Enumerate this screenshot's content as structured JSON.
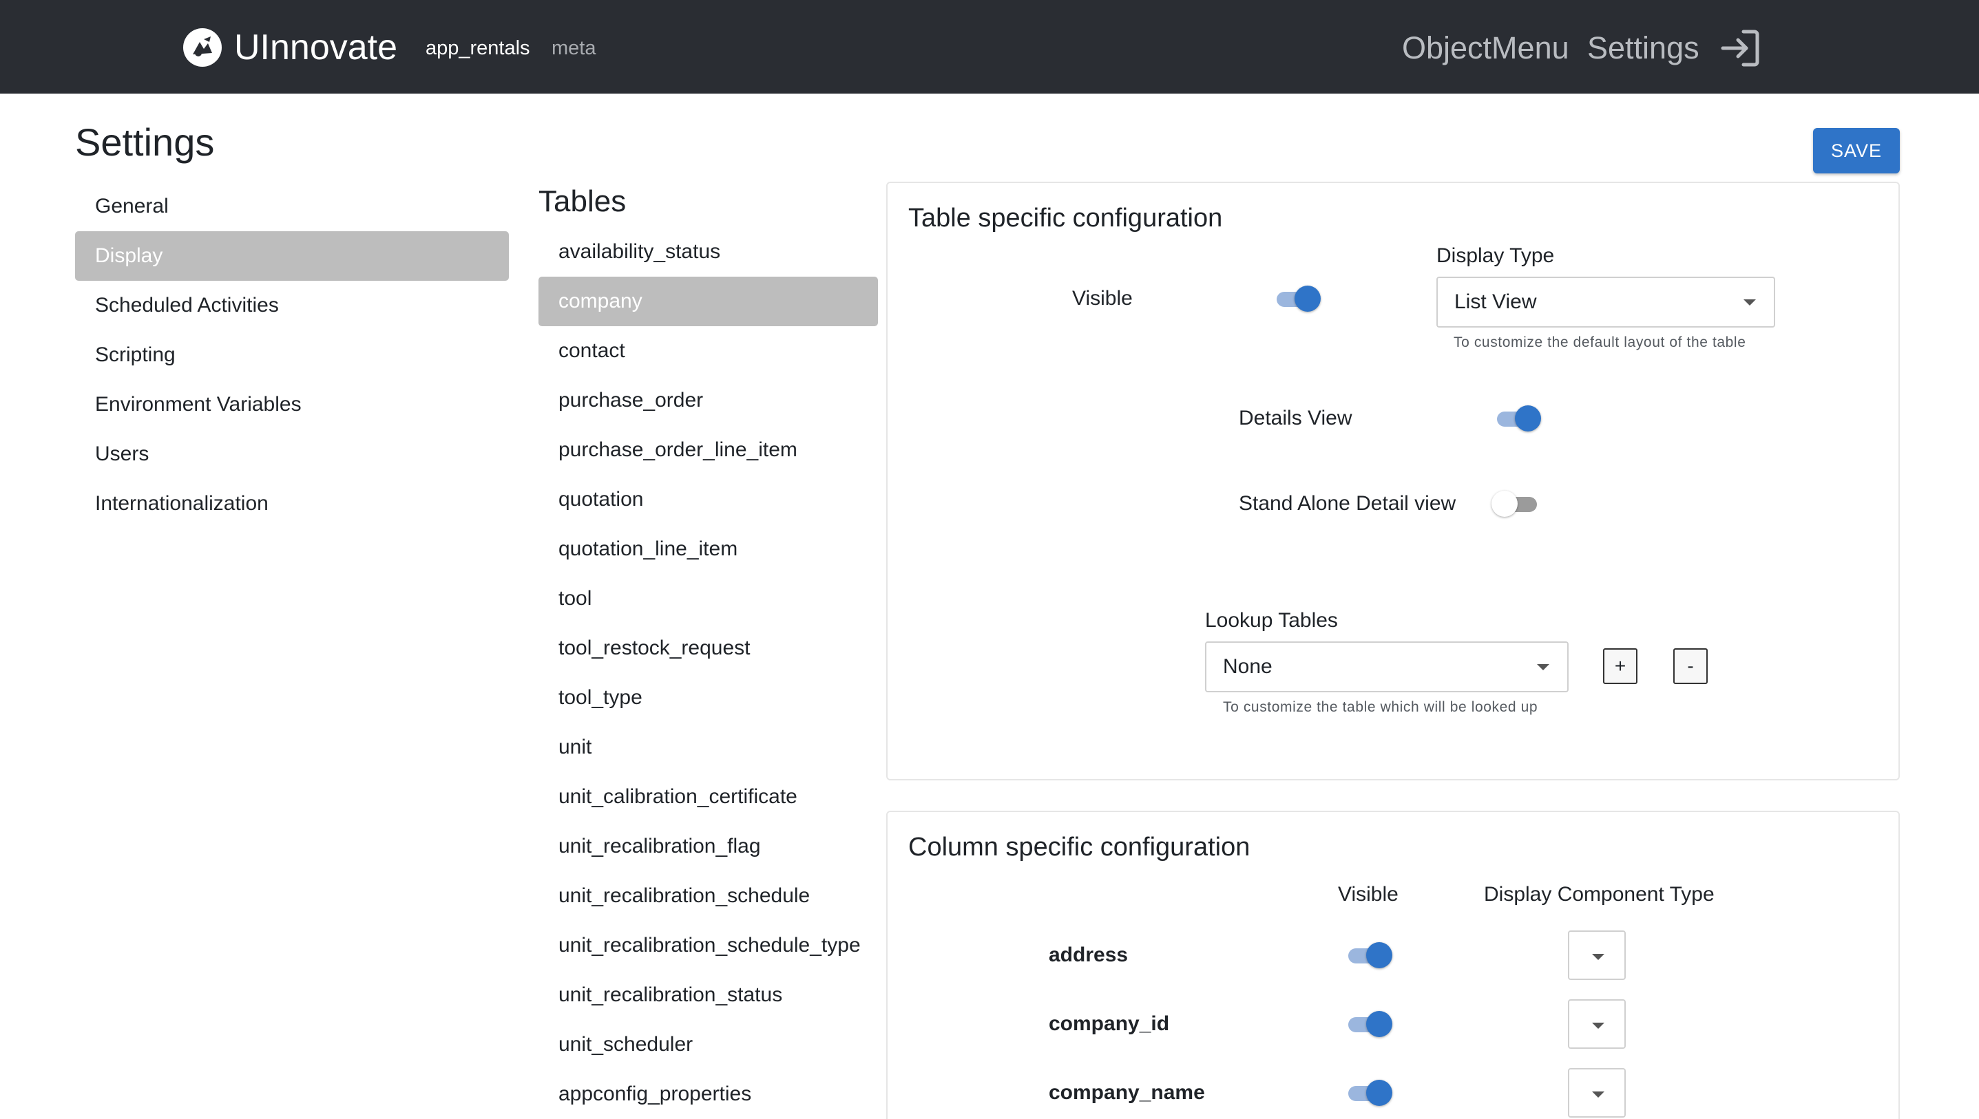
{
  "header": {
    "brand": "UInnovate",
    "app_name": "app_rentals",
    "meta_name": "meta",
    "nav": {
      "objectmenu": "ObjectMenu",
      "settings": "Settings"
    },
    "logo_icon": "logo-icon",
    "logout_icon": "logout-icon"
  },
  "page": {
    "title": "Settings",
    "save_label": "SAVE"
  },
  "settings_menu": {
    "items": [
      {
        "label": "General",
        "active": false
      },
      {
        "label": "Display",
        "active": true
      },
      {
        "label": "Scheduled Activities",
        "active": false
      },
      {
        "label": "Scripting",
        "active": false
      },
      {
        "label": "Environment Variables",
        "active": false
      },
      {
        "label": "Users",
        "active": false
      },
      {
        "label": "Internationalization",
        "active": false
      }
    ]
  },
  "tables": {
    "title": "Tables",
    "items": [
      {
        "label": "availability_status",
        "active": false
      },
      {
        "label": "company",
        "active": true
      },
      {
        "label": "contact",
        "active": false
      },
      {
        "label": "purchase_order",
        "active": false
      },
      {
        "label": "purchase_order_line_item",
        "active": false
      },
      {
        "label": "quotation",
        "active": false
      },
      {
        "label": "quotation_line_item",
        "active": false
      },
      {
        "label": "tool",
        "active": false
      },
      {
        "label": "tool_restock_request",
        "active": false
      },
      {
        "label": "tool_type",
        "active": false
      },
      {
        "label": "unit",
        "active": false
      },
      {
        "label": "unit_calibration_certificate",
        "active": false
      },
      {
        "label": "unit_recalibration_flag",
        "active": false
      },
      {
        "label": "unit_recalibration_schedule",
        "active": false
      },
      {
        "label": "unit_recalibration_schedule_type",
        "active": false
      },
      {
        "label": "unit_recalibration_status",
        "active": false
      },
      {
        "label": "unit_scheduler",
        "active": false
      },
      {
        "label": "appconfig_properties",
        "active": false
      }
    ]
  },
  "table_config": {
    "title": "Table specific configuration",
    "visible_label": "Visible",
    "visible_on": true,
    "display_type_label": "Display Type",
    "display_type_value": "List View",
    "display_type_helper": "To customize the default layout of the table",
    "details_view_label": "Details View",
    "details_view_on": true,
    "standalone_label": "Stand Alone Detail view",
    "standalone_on": false,
    "lookup_label": "Lookup Tables",
    "lookup_value": "None",
    "lookup_helper": "To customize the table which will be looked up",
    "add_label": "+",
    "remove_label": "-"
  },
  "column_config": {
    "title": "Column specific configuration",
    "header_visible": "Visible",
    "header_component": "Display Component Type",
    "rows": [
      {
        "name": "address",
        "visible": true
      },
      {
        "name": "company_id",
        "visible": true
      },
      {
        "name": "company_name",
        "visible": true
      }
    ]
  },
  "colors": {
    "topbar": "#2a2d33",
    "accent": "#2f74c8",
    "active_item": "#bdbdbd"
  }
}
